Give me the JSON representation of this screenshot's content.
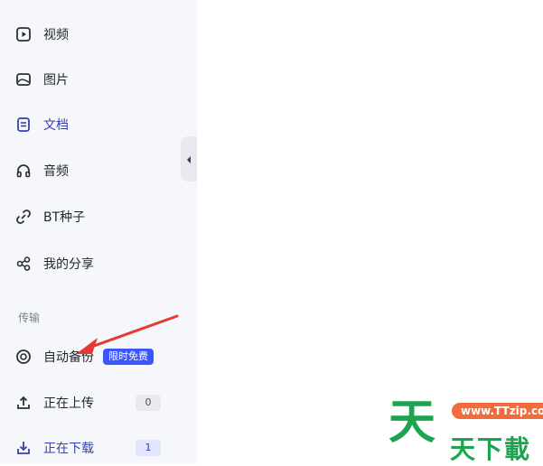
{
  "sidebar": {
    "items": [
      {
        "label": "视频",
        "icon": "video-icon"
      },
      {
        "label": "图片",
        "icon": "image-icon"
      },
      {
        "label": "文档",
        "icon": "document-icon"
      },
      {
        "label": "音频",
        "icon": "headphones-icon"
      },
      {
        "label": "BT种子",
        "icon": "link-icon"
      },
      {
        "label": "我的分享",
        "icon": "share-icon"
      }
    ],
    "transfer_section": {
      "title": "传输",
      "auto_backup": {
        "label": "自动备份",
        "badge": "限时免费",
        "icon": "backup-icon"
      },
      "uploading": {
        "label": "正在上传",
        "count": "0",
        "icon": "upload-icon"
      },
      "downloading": {
        "label": "正在下载",
        "count": "1",
        "icon": "download-icon"
      }
    }
  },
  "colors": {
    "accent": "#3540b3",
    "badge": "#3a56ff",
    "annotation_arrow": "#e53935"
  },
  "watermark": {
    "big": "天",
    "url": "www.TTzip.com",
    "sub": "天下載"
  }
}
